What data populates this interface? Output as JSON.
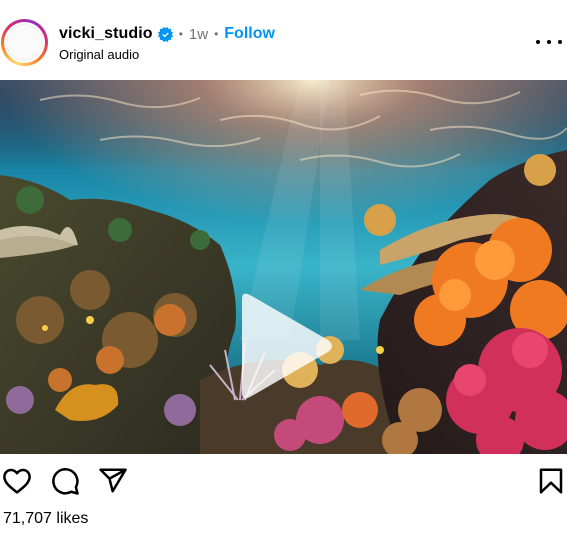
{
  "post": {
    "username": "vicki_studio",
    "verified": true,
    "separator": "•",
    "time": "1w",
    "follow_label": "Follow",
    "audio": "Original audio",
    "likes": "71,707 likes"
  },
  "media": {
    "type": "video",
    "description_kind": "underwater coral reef"
  },
  "icons": {
    "more": "more-options-icon",
    "like": "heart-icon",
    "comment": "comment-icon",
    "share": "share-icon",
    "save": "bookmark-icon",
    "play": "play-icon",
    "verified": "verified-badge-icon"
  },
  "colors": {
    "link": "#0095f6",
    "muted": "#737373",
    "verified": "#0095f6"
  }
}
